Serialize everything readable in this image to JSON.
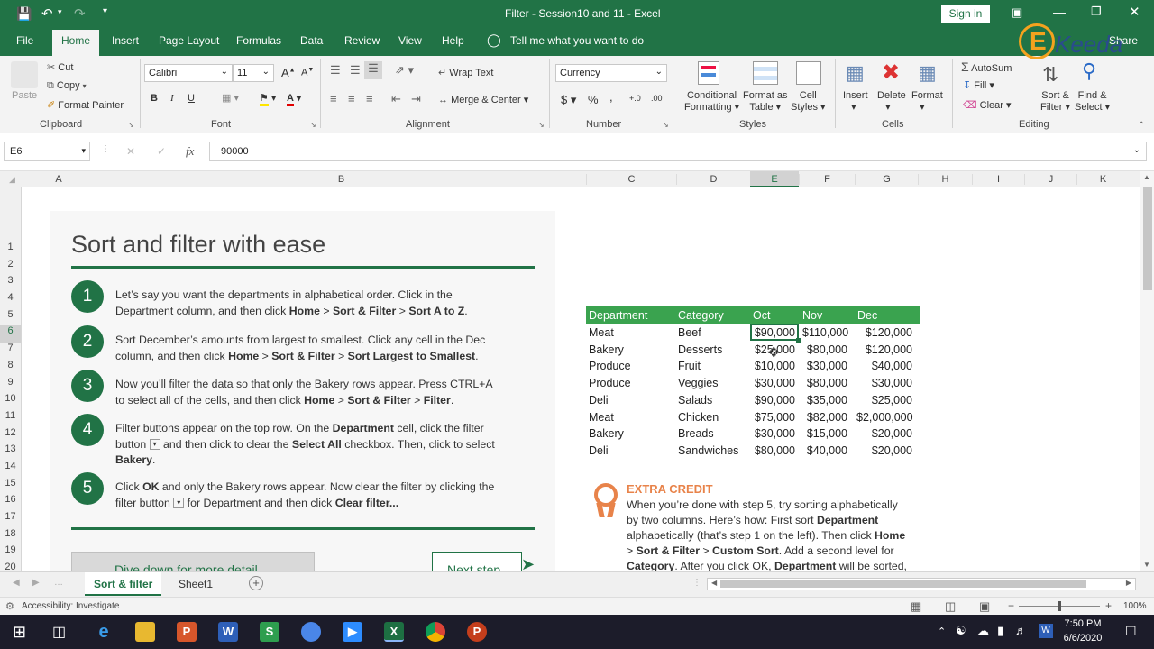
{
  "titlebar": {
    "title": "Filter - Session10 and 11  -  Excel",
    "sign_in": "Sign in"
  },
  "ribbon_tabs": [
    "File",
    "Home",
    "Insert",
    "Page Layout",
    "Formulas",
    "Data",
    "Review",
    "View",
    "Help"
  ],
  "tell_me": "Tell me what you want to do",
  "share_label": "Share",
  "watermark": "Keeda",
  "clipboard": {
    "paste": "Paste",
    "cut": "Cut",
    "copy": "Copy",
    "format_painter": "Format Painter",
    "group": "Clipboard"
  },
  "font": {
    "name": "Calibri",
    "size": "11",
    "bold": "B",
    "italic": "I",
    "underline": "U",
    "grow": "A",
    "shrink": "A",
    "font_color": "A",
    "group": "Font"
  },
  "alignment": {
    "wrap_text": "Wrap Text",
    "merge_center": "Merge & Center",
    "group": "Alignment"
  },
  "number": {
    "format": "Currency",
    "currency_sym": "$",
    "percent": "%",
    "comma": ",",
    "increase_decimal": "+.0",
    "decrease_decimal": ".00",
    "group": "Number"
  },
  "styles": {
    "conditional_1": "Conditional",
    "conditional_2": "Formatting",
    "format_table_1": "Format as",
    "format_table_2": "Table",
    "cell_styles_1": "Cell",
    "cell_styles_2": "Styles",
    "group": "Styles"
  },
  "cells": {
    "insert": "Insert",
    "delete": "Delete",
    "format": "Format",
    "group": "Cells"
  },
  "editing": {
    "autosum": "AutoSum",
    "fill": "Fill",
    "clear": "Clear",
    "sort_filter_1": "Sort &",
    "sort_filter_2": "Filter",
    "find_select_1": "Find &",
    "find_select_2": "Select",
    "group": "Editing"
  },
  "formula_bar": {
    "name_box": "E6",
    "fx": "fx",
    "cancel": "✕",
    "enter": "✓",
    "value": "90000"
  },
  "columns": [
    "A",
    "B",
    "C",
    "D",
    "E",
    "F",
    "G",
    "H",
    "I",
    "J",
    "K"
  ],
  "rows": [
    "1",
    "2",
    "3",
    "4",
    "5",
    "6",
    "7",
    "8",
    "9",
    "10",
    "11",
    "12",
    "13",
    "14",
    "15",
    "16",
    "17",
    "18",
    "19",
    "20"
  ],
  "tutorial": {
    "title": "Sort and filter with ease",
    "steps": [
      {
        "num": "1",
        "l1": "Let’s say you want the departments in alphabetical order. Click in the",
        "l2a": "Department column, and then click ",
        "l2b": "Home",
        "l2c": " > ",
        "l2d": "Sort & Filter",
        "l2e": " > ",
        "l2f": "Sort A to Z",
        "l2g": "."
      },
      {
        "num": "2",
        "l1": "Sort December’s amounts from largest to smallest. Click any cell in the Dec",
        "l2a": "column, and then click ",
        "l2b": "Home",
        "l2c": " > ",
        "l2d": "Sort & Filter",
        "l2e": " > ",
        "l2f": "Sort Largest to Smallest",
        "l2g": "."
      },
      {
        "num": "3",
        "l1": "Now you’ll filter the data so that only the Bakery rows appear. Press CTRL+A",
        "l2a": "to select all of the cells, and then click ",
        "l2b": "Home",
        "l2c": " > ",
        "l2d": "Sort & Filter",
        "l2e": " > ",
        "l2f": "Filter",
        "l2g": "."
      },
      {
        "num": "4",
        "l1a": "Filter buttons appear on the top row. On the ",
        "l1b": "Department",
        "l1c": " cell, click the filter",
        "l2a": "button ",
        "l2b": " and then click to clear the ",
        "l2c": "Select All",
        "l2d": " checkbox. Then, click to select",
        "l3": "Bakery",
        "l3b": "."
      },
      {
        "num": "5",
        "l1a": "Click ",
        "l1b": "OK",
        "l1c": " and only the Bakery rows appear. Now clear the filter by clicking the",
        "l2a": "filter button ",
        "l2b": " for Department and then click ",
        "l2c": "Clear filter..."
      }
    ],
    "dive_button": "Dive down for more detail",
    "next_button": "Next step"
  },
  "table": {
    "headers": [
      "Department",
      "Category",
      "Oct",
      "Nov",
      "Dec"
    ],
    "rows": [
      [
        "Meat",
        "Beef",
        "$90,000",
        "$110,000",
        "$120,000"
      ],
      [
        "Bakery",
        "Desserts",
        "$25,000",
        "$80,000",
        "$120,000"
      ],
      [
        "Produce",
        "Fruit",
        "$10,000",
        "$30,000",
        "$40,000"
      ],
      [
        "Produce",
        "Veggies",
        "$30,000",
        "$80,000",
        "$30,000"
      ],
      [
        "Deli",
        "Salads",
        "$90,000",
        "$35,000",
        "$25,000"
      ],
      [
        "Meat",
        "Chicken",
        "$75,000",
        "$82,000",
        "$2,000,000"
      ],
      [
        "Bakery",
        "Breads",
        "$30,000",
        "$15,000",
        "$20,000"
      ],
      [
        "Deli",
        "Sandwiches",
        "$80,000",
        "$40,000",
        "$20,000"
      ]
    ]
  },
  "extra_credit": {
    "title": "EXTRA CREDIT",
    "l1": "When you’re done with step 5, try sorting alphabetically",
    "l2a": "by two columns. Here’s how: First sort ",
    "l2b": "Department",
    "l3a": "alphabetically (that’s step 1 on the left). Then click ",
    "l3b": "Home",
    "l4a": "> ",
    "l4b": "Sort & Filter",
    "l4c": " > ",
    "l4d": "Custom Sort",
    "l4e": ". Add a second level for",
    "l5a": "Category",
    "l5b": ". After you click OK, ",
    "l5c": "Department",
    "l5d": " will be sorted,"
  },
  "sheet_tabs": [
    "Sort & filter",
    "Sheet1"
  ],
  "status": {
    "accessibility": "Accessibility: Investigate",
    "zoom": "100%"
  },
  "taskbar": {
    "time": "7:50 PM",
    "date": "6/6/2020"
  },
  "colors": {
    "excel_green": "#217346",
    "table_header": "#3aa34f",
    "step_green": "#217346",
    "extra_credit": "#e8834a"
  }
}
